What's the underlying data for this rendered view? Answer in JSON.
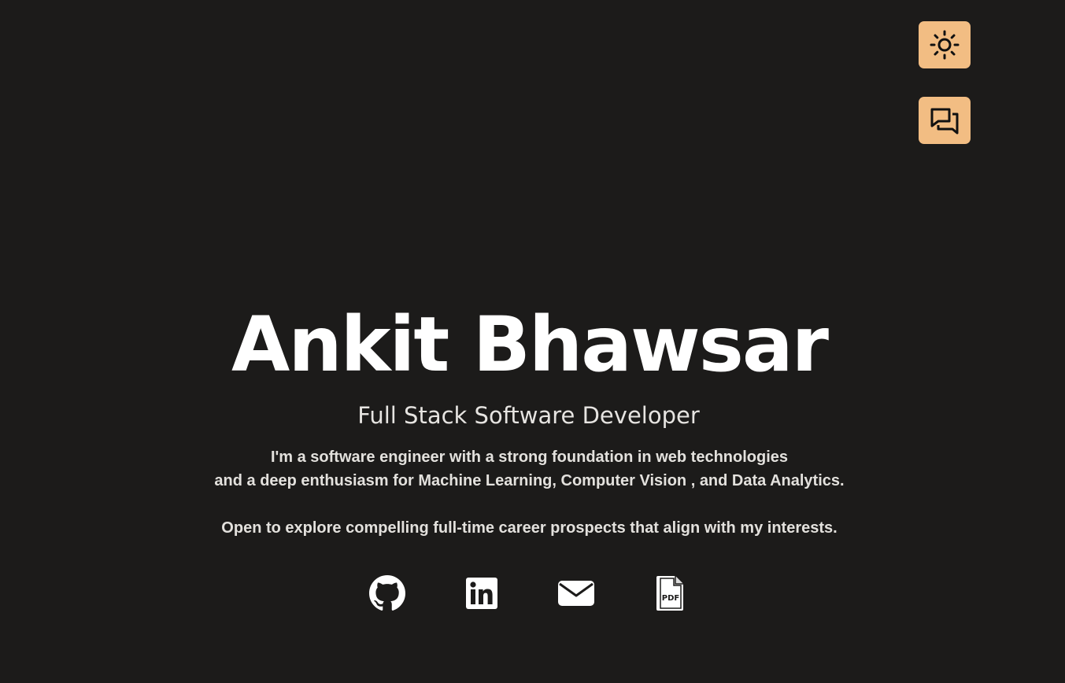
{
  "header": {
    "theme_toggle_icon": "sun-icon",
    "chat_button_icon": "chat-bubbles-icon",
    "accent_color": "#f2bd83"
  },
  "hero": {
    "name": "Ankit Bhawsar",
    "role": "Full Stack Software Developer",
    "bio_line_1": "I'm a software engineer with a strong foundation in web technologies",
    "bio_line_2": "and a deep enthusiasm for  Machine Learning, Computer Vision , and Data Analytics.",
    "bio_line_3": "Open to explore compelling full-time career prospects that align with my interests."
  },
  "socials": [
    {
      "icon": "github-icon"
    },
    {
      "icon": "linkedin-icon"
    },
    {
      "icon": "email-icon"
    },
    {
      "icon": "pdf-resume-icon",
      "label": "PDF"
    }
  ],
  "colors": {
    "background": "#1c1b1a",
    "text": "#ffffff"
  }
}
